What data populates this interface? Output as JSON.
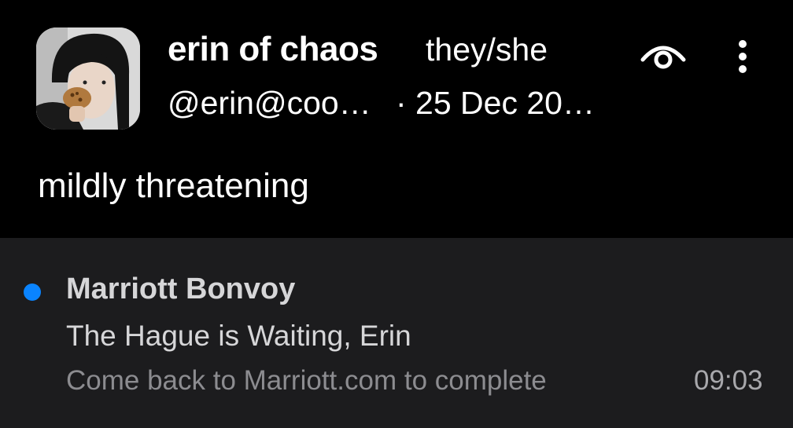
{
  "post": {
    "avatar_icon": "user-avatar-photo",
    "display_name": "erin of chaos",
    "pronouns": "they/she",
    "handle": "@erin@coo…",
    "date": "· 25 Dec 20…",
    "visibility_icon": "eye-icon",
    "menu_icon": "more-vertical-icon",
    "text": "mildly threatening"
  },
  "notification": {
    "unread_color": "#0a84ff",
    "sender": "Marriott Bonvoy",
    "subject": "The Hague is Waiting, Erin",
    "preview": "Come back to Marriott.com to complete",
    "time": "09:03"
  }
}
